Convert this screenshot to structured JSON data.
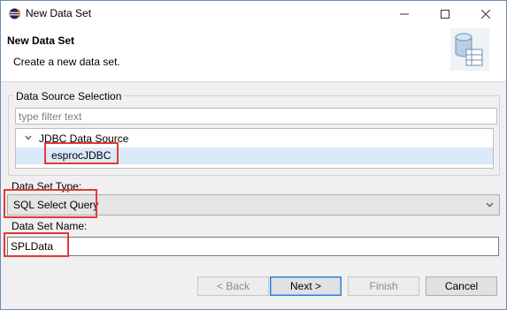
{
  "window": {
    "title": "New Data Set"
  },
  "header": {
    "title": "New Data Set",
    "description": "Create a new data set.",
    "icon": "database-icon"
  },
  "data_source": {
    "group_title": "Data Source Selection",
    "filter_placeholder": "type filter text",
    "tree": {
      "parent": {
        "label": "JDBC Data Source",
        "expanded": true
      },
      "child": {
        "label": "esprocJDBC",
        "selected": true
      }
    }
  },
  "data_set_type": {
    "label": "Data Set Type:",
    "value": "SQL Select Query"
  },
  "data_set_name": {
    "label": "Data Set Name:",
    "value": "SPLData"
  },
  "buttons": {
    "back": "< Back",
    "next": "Next >",
    "finish": "Finish",
    "cancel": "Cancel"
  },
  "colors": {
    "highlight": "#e03a3a",
    "selection": "#dbe9f8",
    "accent": "#2a7cd0"
  }
}
